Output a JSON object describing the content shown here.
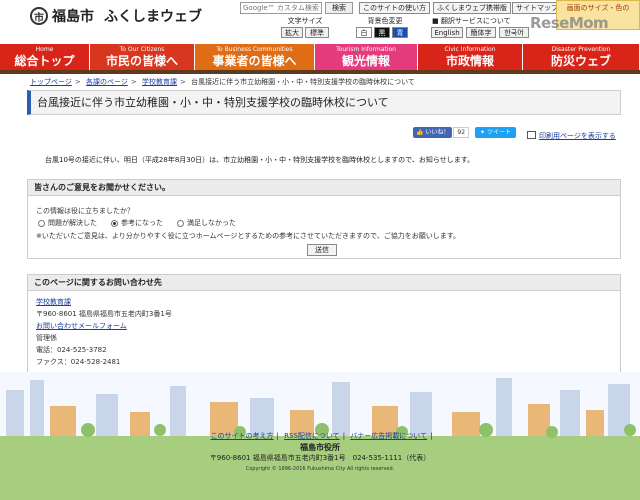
{
  "header": {
    "emblem": "市",
    "city_name": "福島市",
    "site_name": "ふくしまウェブ",
    "search_placeholder": "Google™ カスタム検索",
    "search_button": "検索",
    "utility_links": [
      "このサイトの使い方",
      "ふくしまウェブ携帯版",
      "サイトマップ"
    ],
    "mascot_text": "画面のサイズ・色の",
    "font_size_label": "文字サイズ",
    "font_size_buttons": [
      "拡大",
      "標準"
    ],
    "bg_color_label": "背景色変更",
    "bg_color_buttons": [
      "白",
      "黒",
      "青"
    ],
    "translate_label": "翻訳サービスについて",
    "language_buttons": [
      "English",
      "簡体字",
      "한국어"
    ]
  },
  "watermark": "ReseMom",
  "nav": [
    {
      "en": "Home",
      "jp": "総合トップ",
      "color": "#d9241a"
    },
    {
      "en": "To Our Citizens",
      "jp": "市民の皆様へ",
      "color": "#d9361f"
    },
    {
      "en": "To Business Communities",
      "jp": "事業者の皆様へ",
      "color": "#e06c16"
    },
    {
      "en": "Tourism Information",
      "jp": "観光情報",
      "color": "#e33b7b"
    },
    {
      "en": "Civic Information",
      "jp": "市政情報",
      "color": "#d9241a"
    },
    {
      "en": "Disaster Prevention",
      "jp": "防災ウェブ",
      "color": "#d9241a"
    }
  ],
  "breadcrumb": [
    "トップページ",
    "各課のページ",
    "学校教育課",
    "台風接近に伴う市立幼稚園・小・中・特別支援学校の臨時休校について"
  ],
  "page_title": "台風接近に伴う市立幼稚園・小・中・特別支援学校の臨時休校について",
  "social": {
    "like_label": "いいね！",
    "like_count": "92",
    "tweet_label": "ツイート"
  },
  "print_label": "印刷用ページを表示する",
  "body_text": "台風10号の接近に伴い、明日（平成28年8月30日）は、市立幼稚園・小・中・特別支援学校を臨時休校としますので、お知らせします。",
  "feedback": {
    "heading": "皆さんのご意見をお聞かせください。",
    "question": "この情報は役に立ちましたか？",
    "options": [
      "問題が解決した",
      "参考になった",
      "満足しなかった"
    ],
    "selected": 1,
    "note": "※いただいたご意見は、より分かりやすく役に立つホームページとするための参考にさせていただきますので、ご協力をお願いします。",
    "submit": "送信"
  },
  "contact": {
    "heading": "このページに関するお問い合わせ先",
    "dept": "学校教育課",
    "address": "〒960-8601 福島県福島市五老内町3番1号",
    "form_link": "お問い合わせメールフォーム",
    "section": "管理係",
    "phone": "電話：024-525-3782",
    "fax": "ファクス：024-528-2481"
  },
  "footer": {
    "links": [
      "このサイトの考え方",
      "RSS配信について",
      "バナー広告掲載について"
    ],
    "city_office": "福島市役所",
    "address": "〒960-8601 福島県福島市五老内町3番1号　024-535-1111（代表）",
    "copyright": "Copyright © 1996-2016 Fukushima City All rights reserved."
  }
}
